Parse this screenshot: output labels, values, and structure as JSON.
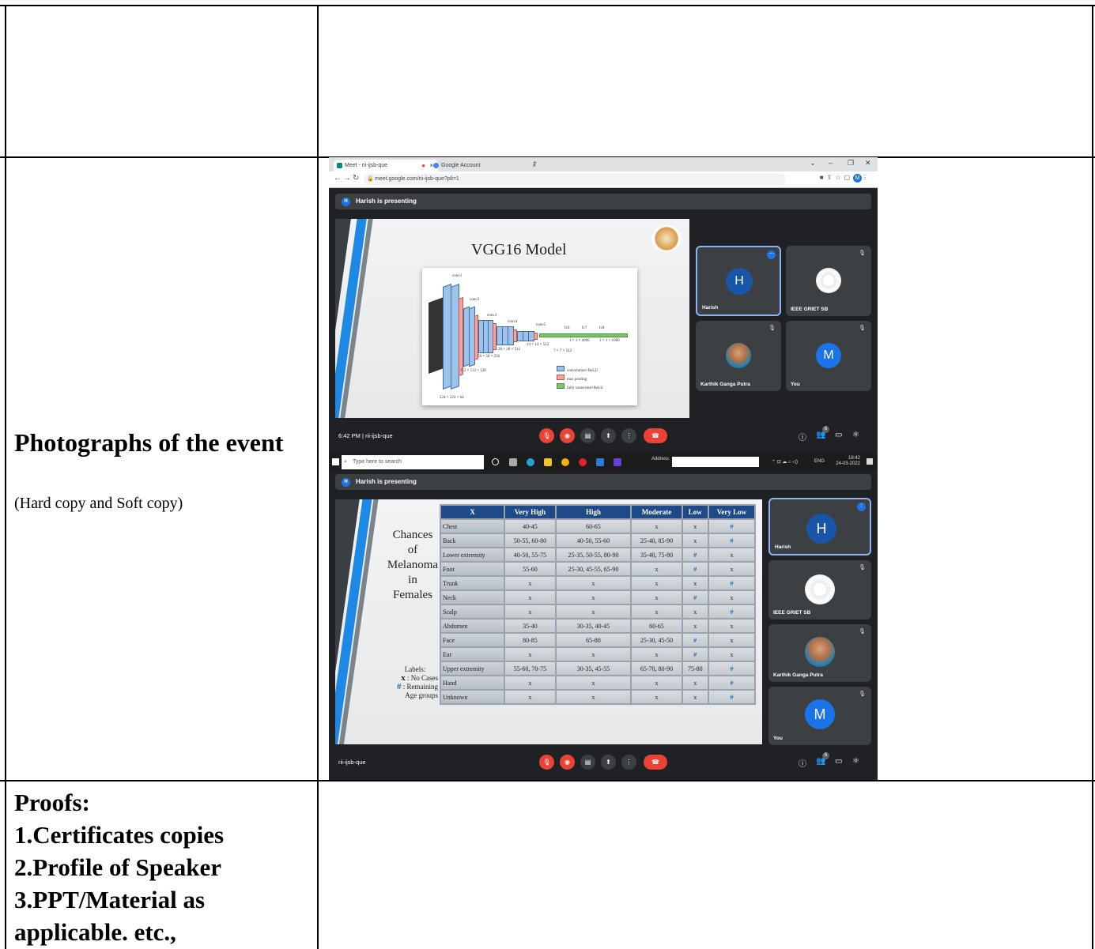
{
  "row_label": {
    "title": "Photographs of the event",
    "subtitle": "(Hard copy and Soft copy)"
  },
  "proofs": {
    "heading": "Proofs:",
    "items": [
      "1.Certificates copies",
      "2.Profile of Speaker",
      "3.PPT/Material as",
      "applicable. etc.,"
    ]
  },
  "screenshot1": {
    "tabs": [
      {
        "label": "Meet - rii-ijsb-que",
        "close": "×"
      },
      {
        "label": "Google Account",
        "close": "×"
      }
    ],
    "new_tab": "+",
    "window_controls": [
      "⌄",
      "–",
      "❐",
      "✕"
    ],
    "url": "meet.google.com/rii-ijsb-que?pli=1",
    "account_initial": "M",
    "presenting": "Harish is presenting",
    "presenter_initial": "H",
    "slide_title": "VGG16 Model",
    "diagram_labels": {
      "conv1": "conv1",
      "conv2": "conv2",
      "conv3": "conv3",
      "conv4": "conv4",
      "conv5": "conv5",
      "fc6": "fc6",
      "fc7": "fc7",
      "fc8": "fc8",
      "d224": "224 × 224 × 64",
      "d112": "112 × 112 × 128",
      "d56": "56 × 56 × 256",
      "d28": "28 × 28 × 512",
      "d14": "14 × 14 × 512",
      "d7": "7 × 7 × 512",
      "d4096": "1 × 1 × 4096",
      "d1000": "1 × 1 × 1000",
      "legend": [
        "convolution+ReLU",
        "max pooling",
        "fully connected+ReLU"
      ]
    },
    "participants": [
      {
        "name": "Harish",
        "initial": "H"
      },
      {
        "name": "IEEE GRIET SB",
        "initial": ""
      },
      {
        "name": "Karthik Ganga Putra",
        "initial": ""
      },
      {
        "name": "You",
        "initial": "M"
      }
    ],
    "time_meeting": "6:42 PM  |  rii-ijsb-que",
    "people_count": "6",
    "taskbar": {
      "search_placeholder": "Type here to search",
      "address_label": "Address",
      "lang": "ENG",
      "time": "18:42",
      "date": "24-03-2022"
    }
  },
  "screenshot2": {
    "presenting": "Harish is presenting",
    "presenter_initial": "H",
    "slide_side_title": [
      "Chances",
      "of",
      "Melanoma",
      "in",
      "Females"
    ],
    "labels_legend": {
      "heading": "Labels:",
      "x_line": ": No Cases",
      "hash_line_1": ": Remaining",
      "hash_line_2": "Age groups",
      "x_symbol": "x",
      "hash_symbol": "#"
    },
    "table": {
      "headers": [
        "X",
        "Very High",
        "High",
        "Moderate",
        "Low",
        "Very Low"
      ],
      "rows": [
        [
          "Chest",
          "40-45",
          "60-65",
          "x",
          "x",
          "#"
        ],
        [
          "Back",
          "50-55, 60-80",
          "40-50, 55-60",
          "25-40, 85-90",
          "x",
          "#"
        ],
        [
          "Lower extremity",
          "40-50, 55-75",
          "25-35, 50-55, 80-90",
          "35-40, 75-80",
          "#",
          "x"
        ],
        [
          "Foot",
          "55-60",
          "25-30, 45-55, 65-90",
          "x",
          "#",
          "x"
        ],
        [
          "Trunk",
          "x",
          "x",
          "x",
          "x",
          "#"
        ],
        [
          "Neck",
          "x",
          "x",
          "x",
          "#",
          "x"
        ],
        [
          "Scalp",
          "x",
          "x",
          "x",
          "x",
          "#"
        ],
        [
          "Abdomen",
          "35-40",
          "30-35, 40-45",
          "60-65",
          "x",
          "x"
        ],
        [
          "Face",
          "80-85",
          "65-80",
          "25-30, 45-50",
          "#",
          "x"
        ],
        [
          "Ear",
          "x",
          "x",
          "x",
          "#",
          "x"
        ],
        [
          "Upper extremity",
          "55-60, 70-75",
          "30-35, 45-55",
          "65-70, 80-90",
          "75-80",
          "#"
        ],
        [
          "Hand",
          "x",
          "x",
          "x",
          "x",
          "#"
        ],
        [
          "Unknown",
          "x",
          "x",
          "x",
          "x",
          "#"
        ]
      ]
    },
    "participants": [
      {
        "name": "Harish",
        "initial": "H"
      },
      {
        "name": "IEEE GRIET SB",
        "initial": ""
      },
      {
        "name": "Karthik Ganga Putra",
        "initial": ""
      },
      {
        "name": "You",
        "initial": "M"
      }
    ],
    "meeting_code": "rii-ijsb-que",
    "people_count": "6"
  },
  "colors": {
    "meet_bg": "#202124",
    "tile_bg": "#3c4043",
    "accent_blue": "#1a73e8",
    "red": "#ea4335",
    "table_header": "#1f4a8a"
  }
}
